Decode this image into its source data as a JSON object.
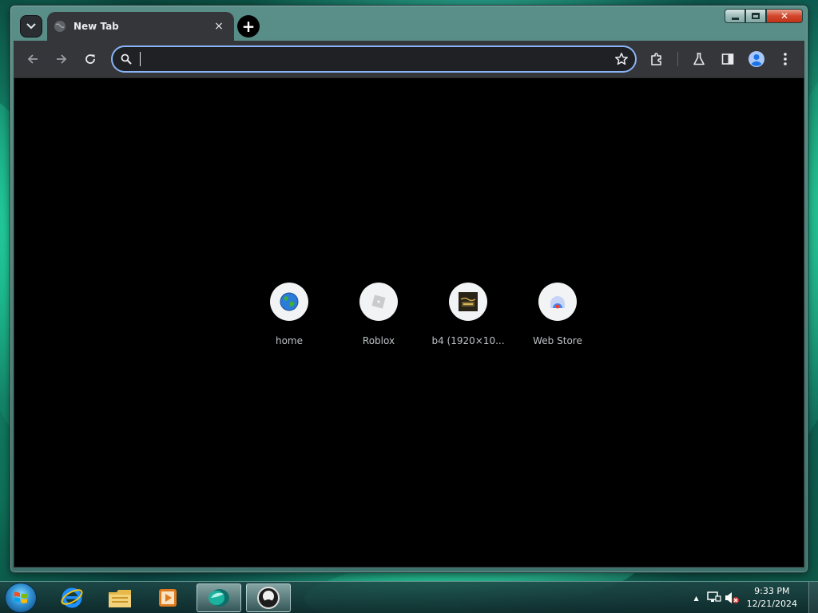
{
  "window": {
    "tab": {
      "title": "New Tab",
      "close_glyph": "×"
    },
    "new_tab_glyph": "+",
    "controls": {
      "close_glyph": "✕"
    }
  },
  "toolbar": {
    "omnibox": {
      "value": "",
      "placeholder": ""
    },
    "icons": [
      "back-arrow-icon",
      "forward-arrow-icon",
      "reload-icon",
      "search-icon",
      "star-icon",
      "extensions-icon",
      "labs-flask-icon",
      "side-panel-icon",
      "profile-icon",
      "menu-dots-icon"
    ]
  },
  "shortcuts": [
    {
      "label": "home",
      "icon": "globe-icon"
    },
    {
      "label": "Roblox",
      "icon": "roblox-icon"
    },
    {
      "label": "b4 (1920×10...",
      "icon": "image-thumbnail-icon"
    },
    {
      "label": "Web Store",
      "icon": "web-store-icon"
    }
  ],
  "taskbar": {
    "apps": [
      "internet-explorer-icon",
      "file-explorer-icon",
      "media-player-icon",
      "browser-icon",
      "app-icon"
    ],
    "clock": {
      "time": "9:33 PM",
      "date": "12/21/2024"
    },
    "tray_arrow": "▲"
  },
  "colors": {
    "accent": "#8ab4f8",
    "toolbar": "#35363a",
    "content_bg": "#000000"
  }
}
